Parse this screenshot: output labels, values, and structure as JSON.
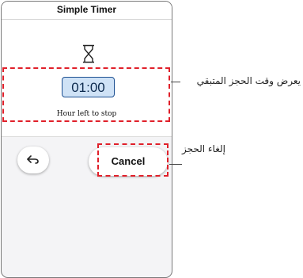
{
  "app": {
    "title": "Simple Timer"
  },
  "timer": {
    "time_remaining": "01:00",
    "caption": "Hour left to stop",
    "icon": "hourglass-icon"
  },
  "actions": {
    "back_icon": "back-arrow-icon",
    "cancel_label": "Cancel"
  },
  "annotations": {
    "time_callout": "يعرض وقت الحجز المتبقي",
    "cancel_callout": "إلغاء الحجز"
  },
  "colors": {
    "highlight": "#e0202a",
    "time_box_bg": "#cfe2f6",
    "time_box_border": "#1c4f91"
  }
}
